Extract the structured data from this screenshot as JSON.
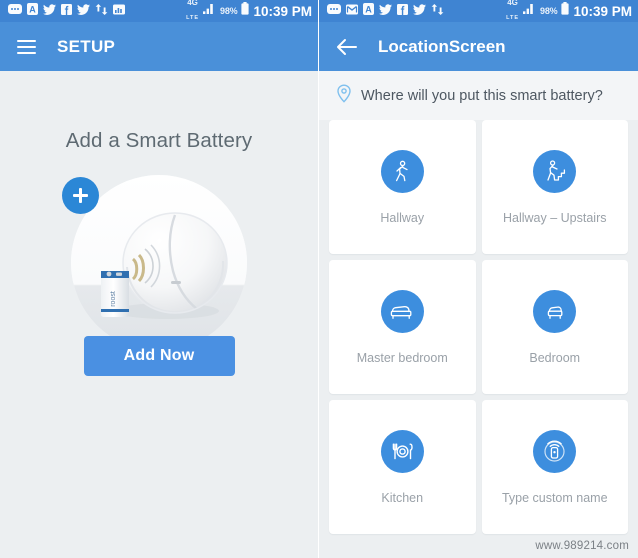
{
  "screens": [
    {
      "id": "setup-screen",
      "statusbar": {
        "icons": [
          "sms-icon",
          "app-a-icon",
          "twitter-icon",
          "facebook-icon",
          "twitter-icon",
          "sync-retweet-icon",
          "gallery-icon"
        ],
        "network": "4G",
        "network_sub": "LTE",
        "battery": "98%",
        "time": "10:39 PM"
      },
      "appbar": {
        "nav_icon": "hamburger-menu-icon",
        "title": "SETUP"
      },
      "content": {
        "headline": "Add a Smart Battery",
        "add_badge_icon": "plus-icon",
        "photo_alt": "smart-battery-and-smoke-detector-photo",
        "primary_button": "Add Now"
      }
    },
    {
      "id": "location-screen",
      "statusbar": {
        "icons": [
          "sms-icon",
          "gmail-icon",
          "app-a-icon",
          "twitter-icon",
          "facebook-icon",
          "twitter-icon",
          "sync-retweet-icon"
        ],
        "network": "4G",
        "network_sub": "LTE",
        "battery": "98%",
        "time": "10:39 PM"
      },
      "appbar": {
        "nav_icon": "back-arrow-icon",
        "title": "LocationScreen"
      },
      "content": {
        "subtitle_icon": "location-pin-icon",
        "subtitle": "Where will you put this smart battery?",
        "locations": [
          {
            "label": "Hallway",
            "icon": "walking-person-icon"
          },
          {
            "label": "Hallway – Upstairs",
            "icon": "person-climbing-stairs-icon"
          },
          {
            "label": "Master bedroom",
            "icon": "double-bed-icon"
          },
          {
            "label": "Bedroom",
            "icon": "single-bed-icon"
          },
          {
            "label": "Kitchen",
            "icon": "cutlery-plate-icon"
          },
          {
            "label": "Type custom name",
            "icon": "smart-device-signal-icon"
          }
        ]
      }
    }
  ],
  "watermark": "www.989214.com",
  "colors": {
    "statusbar": "#3f84d2",
    "appbar": "#4a90d9",
    "accent": "#4a90e2",
    "icon_circle": "#3d8ede",
    "page_background": "#eceff1",
    "card": "#ffffff",
    "label_text": "#9aa1a8",
    "headline_text": "#5e6a72"
  }
}
